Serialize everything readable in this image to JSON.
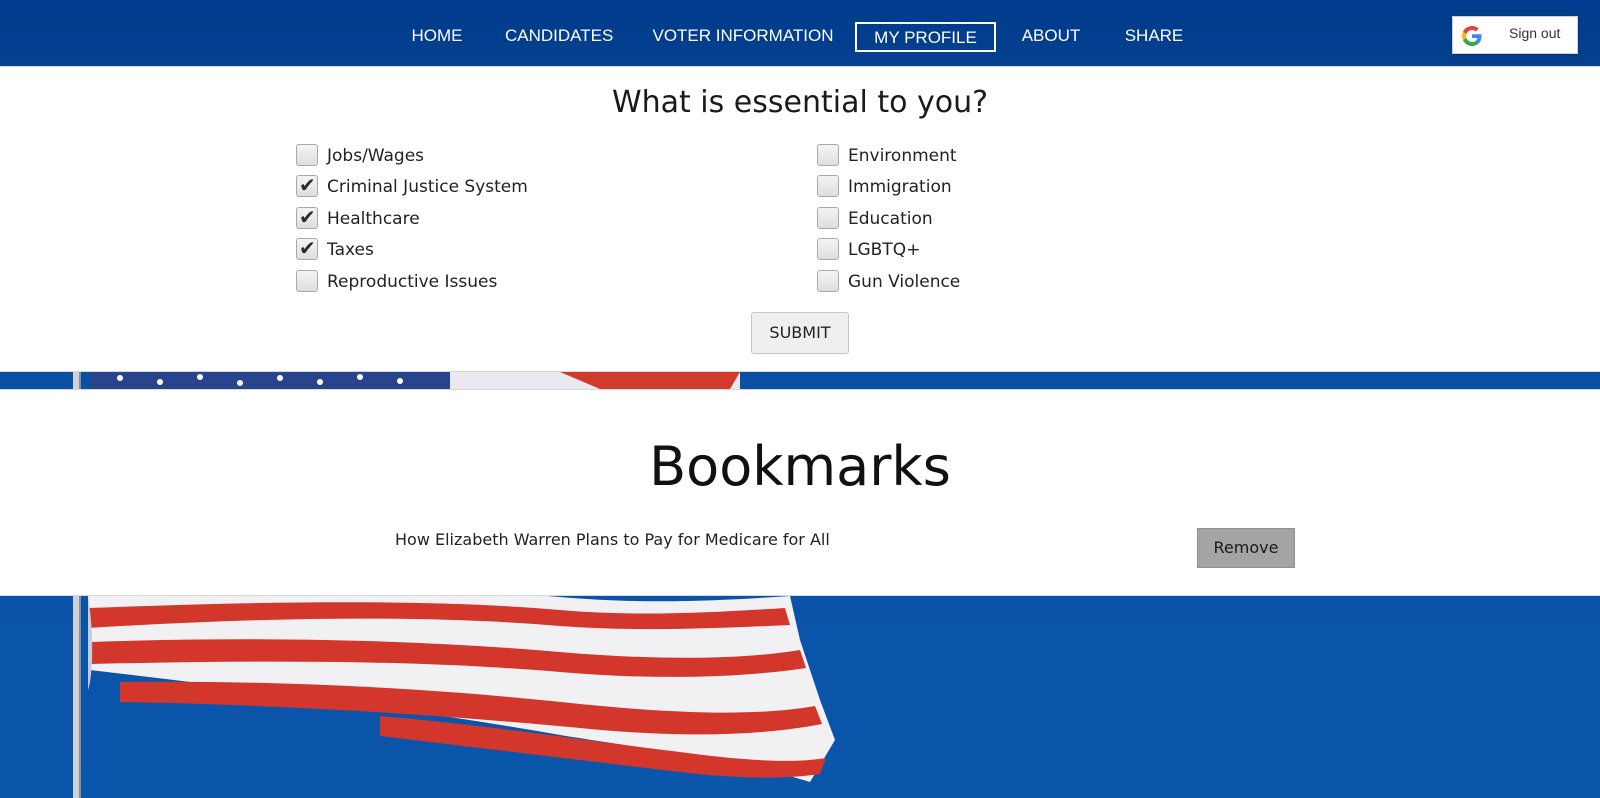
{
  "nav": {
    "items": [
      {
        "label": "HOME"
      },
      {
        "label": "CANDIDATES"
      },
      {
        "label": "VOTER INFORMATION"
      },
      {
        "label": "MY PROFILE",
        "active": true
      },
      {
        "label": "ABOUT"
      },
      {
        "label": "SHARE"
      }
    ],
    "sign_out_label": "Sign out",
    "brand_icon": "google-g-icon"
  },
  "preferences": {
    "title": "What is essential to you?",
    "options_left": [
      {
        "label": "Jobs/Wages",
        "checked": false
      },
      {
        "label": "Criminal Justice System",
        "checked": true
      },
      {
        "label": "Healthcare",
        "checked": true
      },
      {
        "label": "Taxes",
        "checked": true
      },
      {
        "label": "Reproductive Issues",
        "checked": false
      }
    ],
    "options_right": [
      {
        "label": "Environment",
        "checked": false
      },
      {
        "label": "Immigration",
        "checked": false
      },
      {
        "label": "Education",
        "checked": false
      },
      {
        "label": "LGBTQ+",
        "checked": false
      },
      {
        "label": "Gun Violence",
        "checked": false
      }
    ],
    "submit_label": "SUBMIT"
  },
  "bookmarks": {
    "title": "Bookmarks",
    "items": [
      {
        "title": "How Elizabeth Warren Plans to Pay for Medicare for All",
        "remove_label": "Remove"
      }
    ]
  },
  "colors": {
    "nav_bg": "#003a8c",
    "sky": "#0a4ea0",
    "flag_red": "#c8322a",
    "flag_blue": "#1e3f8a"
  }
}
